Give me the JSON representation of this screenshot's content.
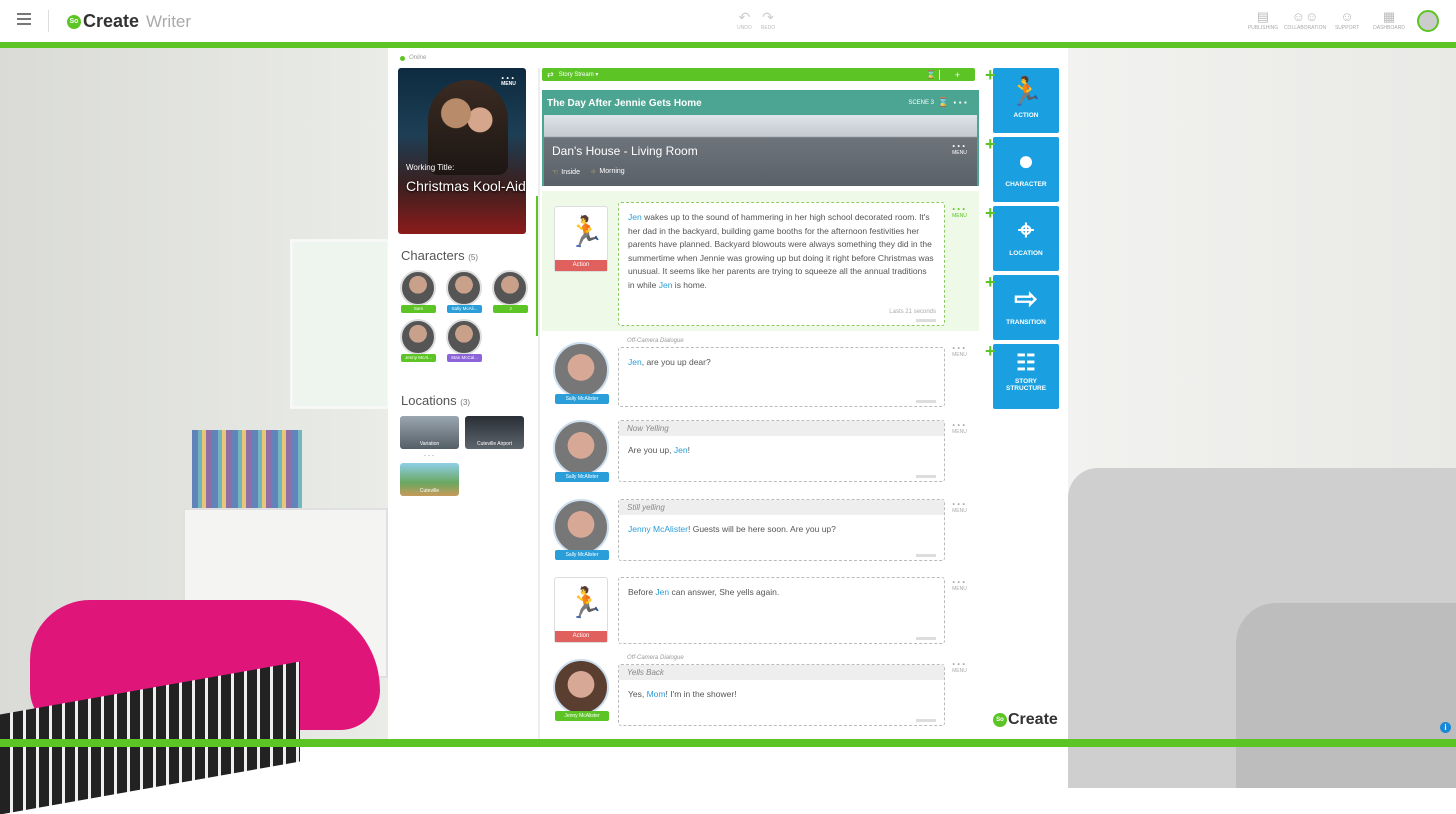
{
  "header": {
    "logo_mark": "So",
    "logo_text": "Create",
    "app_name": "Writer",
    "undo": "UNDO",
    "redo": "REDO",
    "nav": [
      {
        "label": "PUBLISHING",
        "icon": "publishing-icon"
      },
      {
        "label": "COLLABORATION",
        "icon": "collaboration-icon"
      },
      {
        "label": "SUPPORT",
        "icon": "support-icon"
      },
      {
        "label": "DASHBOARD",
        "icon": "dashboard-icon"
      }
    ]
  },
  "status": "Online",
  "book": {
    "menu": "MENU",
    "working_title_label": "Working Title:",
    "title": "Christmas Kool-Aid"
  },
  "characters": {
    "heading": "Characters",
    "count": "(5)",
    "items": [
      {
        "name": "Sam",
        "color": "#5cc525"
      },
      {
        "name": "Sally McAli...",
        "color": "#2a9ed8"
      },
      {
        "name": "J",
        "color": "#5cc525"
      },
      {
        "name": "Jenny McAl...",
        "color": "#5cc525"
      },
      {
        "name": "Stan McCal...",
        "color": "#8c63d8"
      }
    ]
  },
  "locations": {
    "heading": "Locations",
    "count": "(3)",
    "items": [
      "Variation",
      "Cuteville Airport",
      "Cuteville"
    ]
  },
  "stream": {
    "label": "Story Stream ▾",
    "add": "+"
  },
  "scene": {
    "title": "The Day After Jennie Gets Home",
    "number": "SCENE 3",
    "location": "Dan's House - Living Room",
    "setting": "Inside",
    "time": "Morning",
    "menu": "MENU"
  },
  "blocks": {
    "menu": "MENU",
    "action1": {
      "label": "Action",
      "name": "Jen",
      "text": " wakes up to the sound of hammering in her high school decorated room. It's her dad in the backyard, building game booths for the afternoon festivities her parents have planned. Backyard blowouts were always something they did in the summertime when Jennie was growing up but doing it right before Christmas was unusual. It seems like her parents are trying to squeeze all the annual traditions in while ",
      "name2": "Jen",
      "text2": " is home.",
      "lasts": "Lasts 21 seconds"
    },
    "d1": {
      "tag": "Sally McAlister",
      "occ": "Off-Camera Dialogue",
      "name": "Jen",
      "text": ", are you up dear?"
    },
    "d2": {
      "tag": "Sally McAlister",
      "pre": "Now Yelling",
      "text": "Are you up, ",
      "name": "Jen",
      "text2": "!"
    },
    "d3": {
      "tag": "Sally McAlister",
      "pre": "Still yelling",
      "name": "Jenny McAlister",
      "text": "! Guests will be here soon. Are you up?"
    },
    "action2": {
      "label": "Action",
      "text": "Before ",
      "name": "Jen",
      "text2": " can answer, She yells again."
    },
    "d4": {
      "tag": "Jenny McAlister",
      "occ": "Off-Camera Dialogue",
      "pre": "Yells Back",
      "text": "Yes, ",
      "name": "Mom",
      "text2": "! I'm in the shower!"
    }
  },
  "tools": [
    {
      "label": "ACTION",
      "icon": "running-person-icon",
      "glyph": "🏃"
    },
    {
      "label": "CHARACTER",
      "icon": "character-icon",
      "glyph": "●"
    },
    {
      "label": "LOCATION",
      "icon": "location-pin-icon",
      "glyph": "⌖"
    },
    {
      "label": "TRANSITION",
      "icon": "transition-icon",
      "glyph": "⇨"
    },
    {
      "label": "STORY STRUCTURE",
      "icon": "story-structure-icon",
      "glyph": "☷"
    }
  ],
  "brand": {
    "mark": "So",
    "text": "Create"
  },
  "info": "i"
}
